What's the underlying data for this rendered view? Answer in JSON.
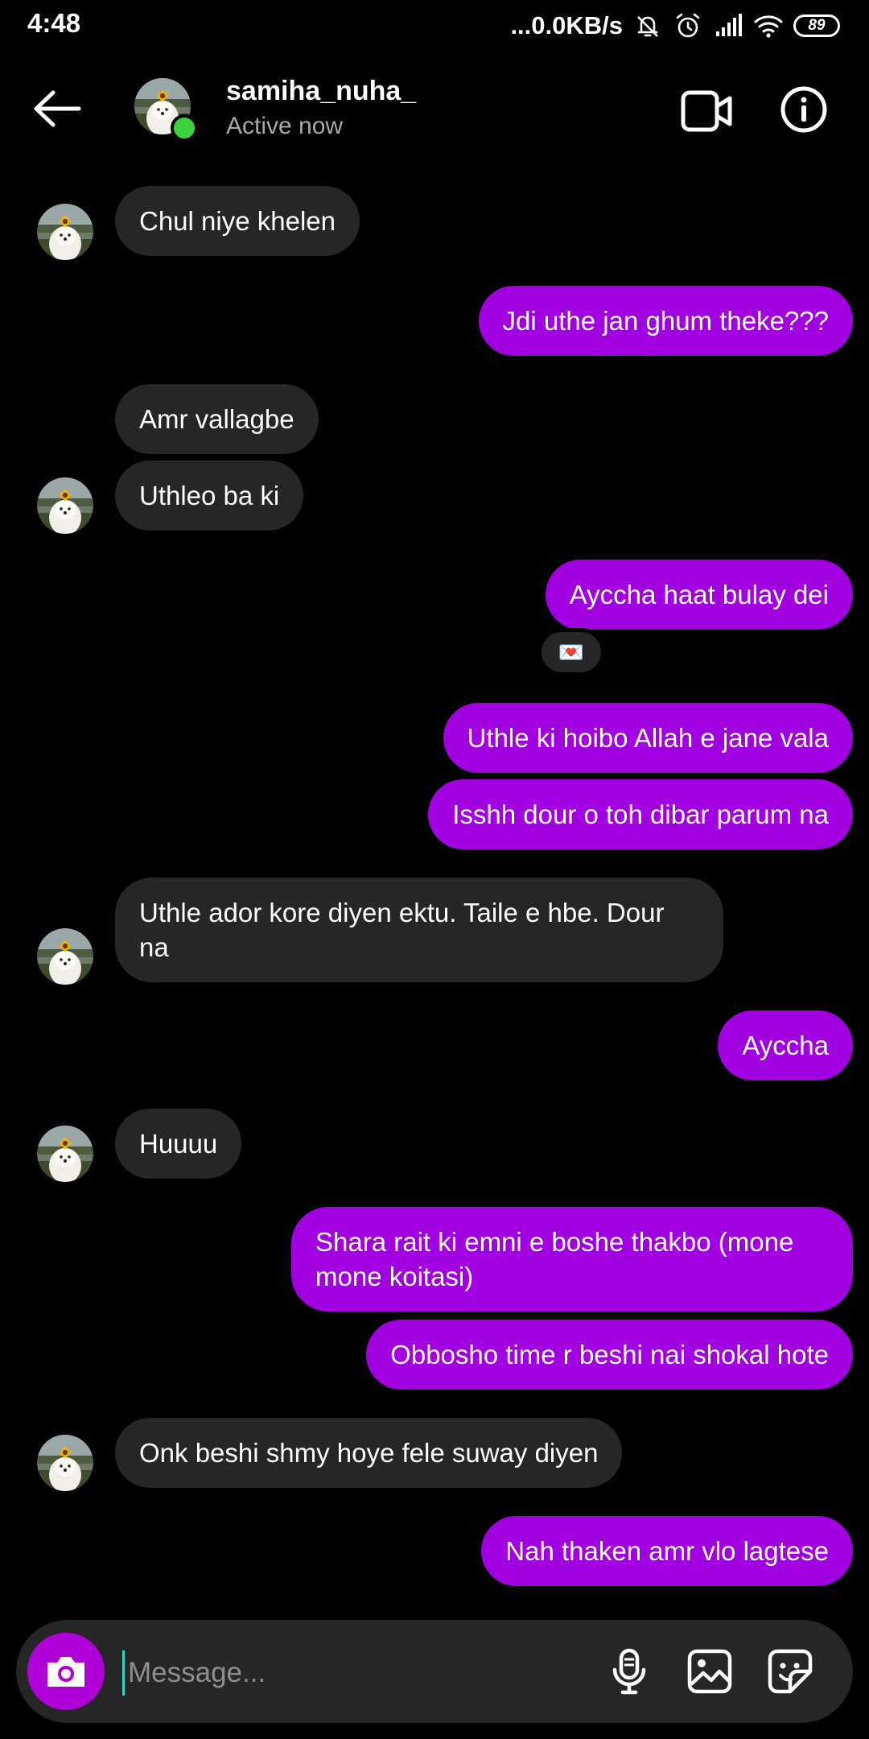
{
  "status_bar": {
    "time": "4:48",
    "network_speed": "...0.0KB/s",
    "battery_level": "89",
    "icons": [
      "mute-bell-icon",
      "alarm-icon",
      "signal-icon",
      "wifi-icon",
      "battery-icon"
    ]
  },
  "header": {
    "username": "samiha_nuha_",
    "status": "Active now",
    "icons": [
      "back-arrow-icon",
      "video-call-icon",
      "info-icon"
    ]
  },
  "messages": [
    {
      "from": "them",
      "text": "Chul niye khelen"
    },
    {
      "from": "me",
      "text": "Jdi uthe jan ghum theke???"
    },
    {
      "from": "them",
      "text": "Amr vallagbe"
    },
    {
      "from": "them",
      "text": "Uthleo ba ki"
    },
    {
      "from": "me",
      "text": "Ayccha haat bulay dei",
      "reaction": "💌"
    },
    {
      "from": "me",
      "text": "Uthle ki hoibo Allah e jane vala"
    },
    {
      "from": "me",
      "text": "Isshh dour o toh dibar parum na"
    },
    {
      "from": "them",
      "text": "Uthle ador kore diyen ektu. Taile e hbe. Dour na"
    },
    {
      "from": "me",
      "text": "Ayccha"
    },
    {
      "from": "them",
      "text": "Huuuu"
    },
    {
      "from": "me",
      "text": "Shara rait ki emni e boshe thakbo (mone mone koitasi)"
    },
    {
      "from": "me",
      "text": "Obbosho time r beshi nai shokal hote"
    },
    {
      "from": "them",
      "text": "Onk beshi shmy hoye fele suway diyen"
    },
    {
      "from": "me",
      "text": "Nah thaken amr vlo lagtese"
    }
  ],
  "composer": {
    "placeholder": "Message...",
    "icons": [
      "camera-icon",
      "microphone-icon",
      "gallery-icon",
      "sticker-icon"
    ]
  },
  "colors": {
    "background": "#000000",
    "incoming_bubble": "#262626",
    "outgoing_bubble": "#a100e0",
    "online": "#3bd23b",
    "camera_button": "#b000d8"
  }
}
